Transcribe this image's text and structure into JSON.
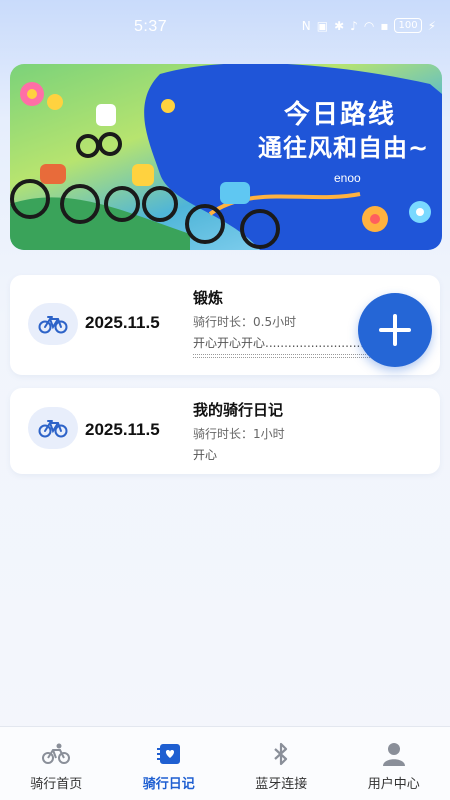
{
  "status_bar": {
    "time": "5:37",
    "battery": "100",
    "icons": [
      "nfc-icon",
      "vibrate-icon",
      "bluetooth-icon",
      "mute-icon",
      "wifi-icon",
      "alert-icon",
      "battery-icon",
      "charging-icon"
    ]
  },
  "banner": {
    "title": "今日路线",
    "subtitle": "通往风和自由~",
    "brand": "enoo"
  },
  "entries": [
    {
      "date": "2025.11.5",
      "title": "锻炼",
      "duration": "骑行时长：0.5小时",
      "note": "开心开心开心........................................."
    },
    {
      "date": "2025.11.5",
      "title": "我的骑行日记",
      "duration": "骑行时长：1小时",
      "note": "开心"
    }
  ],
  "fab": {
    "icon": "plus-icon"
  },
  "tabbar": {
    "tabs": [
      {
        "label": "骑行首页",
        "icon": "bike-icon",
        "active": false
      },
      {
        "label": "骑行日记",
        "icon": "diary-icon",
        "active": true
      },
      {
        "label": "蓝牙连接",
        "icon": "bluetooth-icon",
        "active": false
      },
      {
        "label": "用户中心",
        "icon": "user-icon",
        "active": false
      }
    ]
  },
  "colors": {
    "accent": "#2566d6",
    "active_tab": "#1f5fd1",
    "icon_blue": "#2d63c8"
  }
}
